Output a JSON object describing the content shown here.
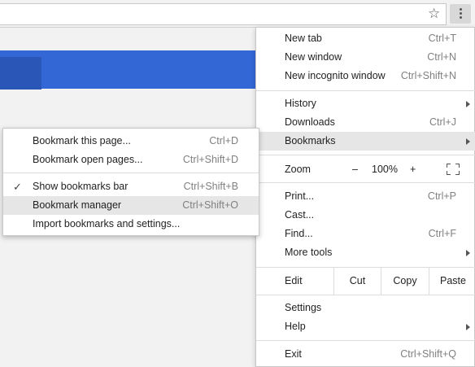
{
  "toolbar": {
    "bookmark_star": "☆",
    "menu_icon": "chrome-menu"
  },
  "menu": {
    "items_top": [
      {
        "label": "New tab",
        "shortcut": "Ctrl+T"
      },
      {
        "label": "New window",
        "shortcut": "Ctrl+N"
      },
      {
        "label": "New incognito window",
        "shortcut": "Ctrl+Shift+N"
      }
    ],
    "items_mid": [
      {
        "label": "History",
        "shortcut": ""
      },
      {
        "label": "Downloads",
        "shortcut": "Ctrl+J"
      },
      {
        "label": "Bookmarks",
        "shortcut": ""
      }
    ],
    "zoom": {
      "label": "Zoom",
      "minus": "–",
      "value": "100%",
      "plus": "+"
    },
    "items_tools": [
      {
        "label": "Print...",
        "shortcut": "Ctrl+P"
      },
      {
        "label": "Cast...",
        "shortcut": ""
      },
      {
        "label": "Find...",
        "shortcut": "Ctrl+F"
      },
      {
        "label": "More tools",
        "shortcut": ""
      }
    ],
    "edit": {
      "label": "Edit",
      "cut": "Cut",
      "copy": "Copy",
      "paste": "Paste"
    },
    "items_settings": [
      {
        "label": "Settings"
      },
      {
        "label": "Help"
      }
    ],
    "exit": {
      "label": "Exit",
      "shortcut": "Ctrl+Shift+Q"
    }
  },
  "bookmarks_submenu": {
    "items": [
      {
        "label": "Bookmark this page...",
        "shortcut": "Ctrl+D"
      },
      {
        "label": "Bookmark open pages...",
        "shortcut": "Ctrl+Shift+D"
      },
      {
        "label": "Show bookmarks bar",
        "shortcut": "Ctrl+Shift+B",
        "checked": true
      },
      {
        "label": "Bookmark manager",
        "shortcut": "Ctrl+Shift+O"
      },
      {
        "label": "Import bookmarks and settings...",
        "shortcut": ""
      }
    ],
    "check_glyph": "✓"
  },
  "colors": {
    "accent_blue": "#3367d6",
    "highlight": "#e6e6e6"
  }
}
